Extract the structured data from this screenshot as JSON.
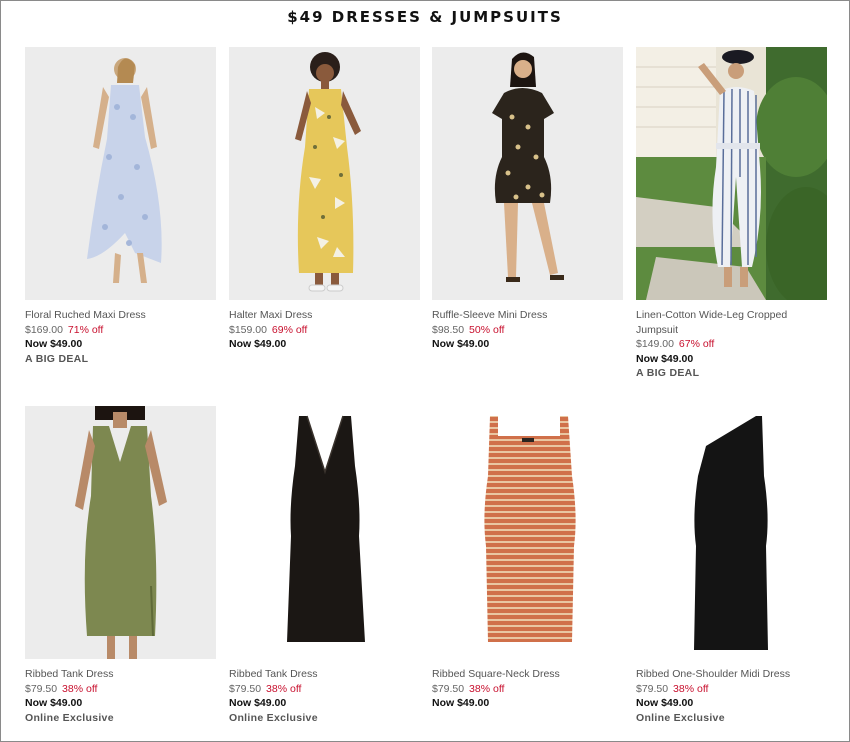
{
  "page_title": "$49 DRESSES & JUMPSUITS",
  "products": [
    {
      "name": "Floral Ruched Maxi Dress",
      "original_price": "$169.00",
      "discount": "71% off",
      "now_price": "Now $49.00",
      "tag": "A BIG DEAL"
    },
    {
      "name": "Halter Maxi Dress",
      "original_price": "$159.00",
      "discount": "69% off",
      "now_price": "Now $49.00",
      "tag": ""
    },
    {
      "name": "Ruffle-Sleeve Mini Dress",
      "original_price": "$98.50",
      "discount": "50% off",
      "now_price": "Now $49.00",
      "tag": ""
    },
    {
      "name": "Linen-Cotton Wide-Leg Cropped Jumpsuit",
      "original_price": "$149.00",
      "discount": "67% off",
      "now_price": "Now $49.00",
      "tag": "A BIG DEAL"
    },
    {
      "name": "Ribbed Tank Dress",
      "original_price": "$79.50",
      "discount": "38% off",
      "now_price": "Now $49.00",
      "tag": "Online Exclusive"
    },
    {
      "name": "Ribbed Tank Dress",
      "original_price": "$79.50",
      "discount": "38% off",
      "now_price": "Now $49.00",
      "tag": "Online Exclusive"
    },
    {
      "name": "Ribbed Square-Neck Dress",
      "original_price": "$79.50",
      "discount": "38% off",
      "now_price": "Now $49.00",
      "tag": ""
    },
    {
      "name": "Ribbed One-Shoulder Midi Dress",
      "original_price": "$79.50",
      "discount": "38% off",
      "now_price": "Now $49.00",
      "tag": "Online Exclusive"
    }
  ],
  "colors": {
    "discount": "#c8102e",
    "photo_bg": "#ececec"
  }
}
